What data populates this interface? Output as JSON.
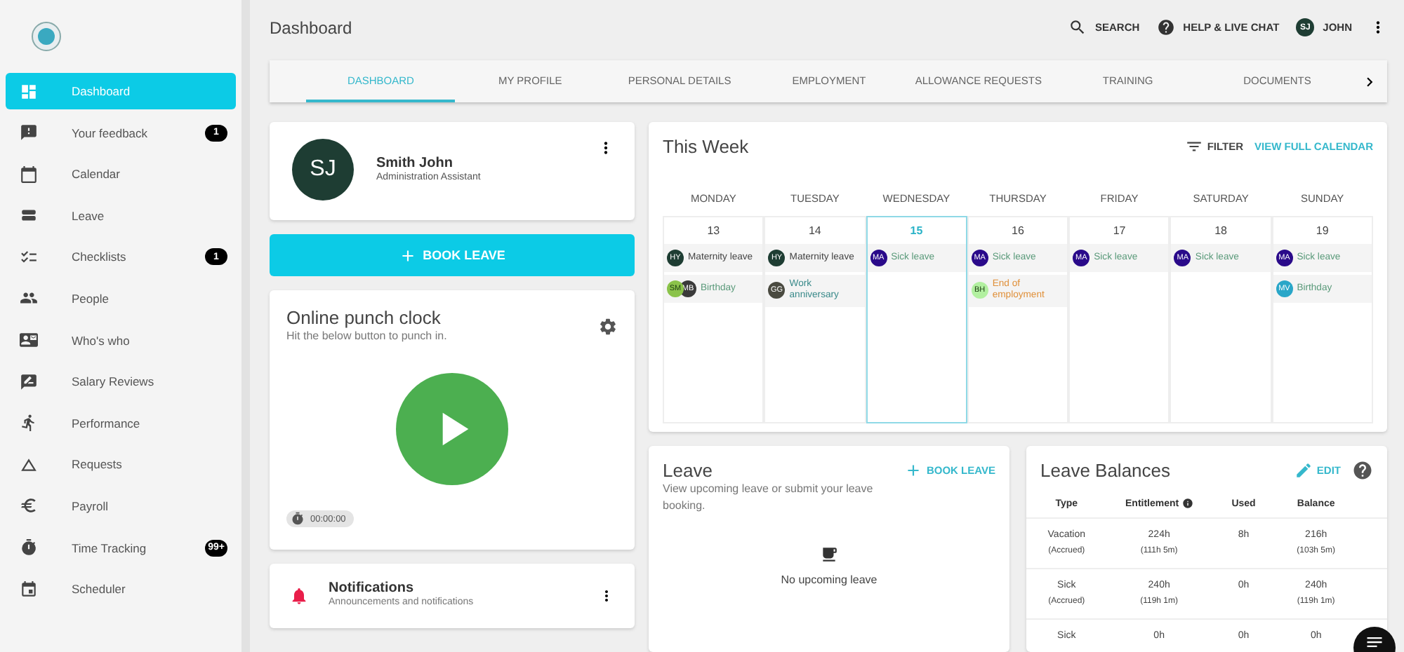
{
  "header": {
    "title": "Dashboard",
    "search": "SEARCH",
    "help": "HELP & LIVE CHAT",
    "user": {
      "initials": "SJ",
      "name": "JOHN"
    }
  },
  "sidebar": {
    "items": [
      {
        "label": "Dashboard",
        "selected": true
      },
      {
        "label": "Your feedback",
        "selected": false,
        "badge": "1"
      },
      {
        "label": "Calendar",
        "selected": false
      },
      {
        "label": "Leave",
        "selected": false
      },
      {
        "label": "Checklists",
        "selected": false,
        "badge": "1"
      },
      {
        "label": "People",
        "selected": false
      },
      {
        "label": "Who's who",
        "selected": false
      },
      {
        "label": "Salary Reviews",
        "selected": false
      },
      {
        "label": "Performance",
        "selected": false
      },
      {
        "label": "Requests",
        "selected": false
      },
      {
        "label": "Payroll",
        "selected": false
      },
      {
        "label": "Time Tracking",
        "selected": false,
        "badge": "99+"
      },
      {
        "label": "Scheduler",
        "selected": false
      }
    ]
  },
  "tabs": [
    {
      "label": "DASHBOARD",
      "selected": true
    },
    {
      "label": "MY PROFILE",
      "selected": false
    },
    {
      "label": "PERSONAL DETAILS",
      "selected": false
    },
    {
      "label": "EMPLOYMENT",
      "selected": false
    },
    {
      "label": "ALLOWANCE REQUESTS",
      "selected": false
    },
    {
      "label": "TRAINING",
      "selected": false
    },
    {
      "label": "DOCUMENTS",
      "selected": false
    }
  ],
  "profile": {
    "initials": "SJ",
    "name": "Smith John",
    "role": "Administration Assistant"
  },
  "book_leave": "BOOK LEAVE",
  "punch_clock": {
    "title": "Online punch clock",
    "subtitle": "Hit the below button to punch in.",
    "timer": "00:00:00"
  },
  "notifications": {
    "title": "Notifications",
    "subtitle": "Announcements and notifications"
  },
  "week": {
    "title": "This Week",
    "filter": "FILTER",
    "view_all": "VIEW FULL CALENDAR",
    "days": [
      {
        "name": "MONDAY",
        "date": "13",
        "selected": false,
        "events": [
          {
            "kind": "leave",
            "label": "Maternity leave",
            "avatars": [
              {
                "initials": "HY",
                "color": "#1e3d33"
              }
            ]
          },
          {
            "kind": "birthday",
            "label": "Birthday",
            "avatars": [
              {
                "initials": "SM",
                "color": "#8bc34a"
              },
              {
                "initials": "MB",
                "color": "#3a3a3a"
              }
            ]
          }
        ]
      },
      {
        "name": "TUESDAY",
        "date": "14",
        "selected": false,
        "events": [
          {
            "kind": "leave",
            "label": "Maternity leave",
            "avatars": [
              {
                "initials": "HY",
                "color": "#1e3d33"
              }
            ]
          },
          {
            "kind": "anniversary",
            "label": "Work anniversary",
            "avatars": [
              {
                "initials": "GG",
                "color": "#4a4a40"
              }
            ]
          }
        ]
      },
      {
        "name": "WEDNESDAY",
        "date": "15",
        "selected": true,
        "events": [
          {
            "kind": "sick",
            "label": "Sick leave",
            "avatars": [
              {
                "initials": "MA",
                "color": "#2a0a8a"
              }
            ]
          }
        ]
      },
      {
        "name": "THURSDAY",
        "date": "16",
        "selected": false,
        "events": [
          {
            "kind": "sick",
            "label": "Sick leave",
            "avatars": [
              {
                "initials": "MA",
                "color": "#2a0a8a"
              }
            ]
          },
          {
            "kind": "end",
            "label": "End of employment",
            "avatars": [
              {
                "initials": "BH",
                "color": "#b2f0a0"
              }
            ]
          }
        ]
      },
      {
        "name": "FRIDAY",
        "date": "17",
        "selected": false,
        "events": [
          {
            "kind": "sick",
            "label": "Sick leave",
            "avatars": [
              {
                "initials": "MA",
                "color": "#2a0a8a"
              }
            ]
          }
        ]
      },
      {
        "name": "SATURDAY",
        "date": "18",
        "selected": false,
        "events": [
          {
            "kind": "sick",
            "label": "Sick leave",
            "avatars": [
              {
                "initials": "MA",
                "color": "#2a0a8a"
              }
            ]
          }
        ]
      },
      {
        "name": "SUNDAY",
        "date": "19",
        "selected": false,
        "events": [
          {
            "kind": "sick",
            "label": "Sick leave",
            "avatars": [
              {
                "initials": "MA",
                "color": "#2a0a8a"
              }
            ]
          },
          {
            "kind": "birthday",
            "label": "Birthday",
            "avatars": [
              {
                "initials": "MV",
                "color": "#29a6c8"
              }
            ]
          }
        ]
      }
    ]
  },
  "leave": {
    "title": "Leave",
    "action": "BOOK LEAVE",
    "subtitle": "View upcoming leave or submit your leave booking.",
    "empty": "No upcoming leave"
  },
  "balances": {
    "title": "Leave Balances",
    "edit": "EDIT",
    "columns": [
      "Type",
      "Entitlement",
      "Used",
      "Balance"
    ],
    "rows": [
      {
        "type": "Vacation",
        "type_note": "(Accrued)",
        "entitlement": "224h",
        "entitlement_note": "(111h 5m)",
        "used": "8h",
        "balance": "216h",
        "balance_note": "(103h 5m)"
      },
      {
        "type": "Sick",
        "type_note": "(Accrued)",
        "entitlement": "240h",
        "entitlement_note": "(119h 1m)",
        "used": "0h",
        "balance": "240h",
        "balance_note": "(119h 1m)"
      },
      {
        "type": "Sick",
        "entitlement": "0h",
        "used": "0h",
        "balance": "0h"
      }
    ]
  }
}
